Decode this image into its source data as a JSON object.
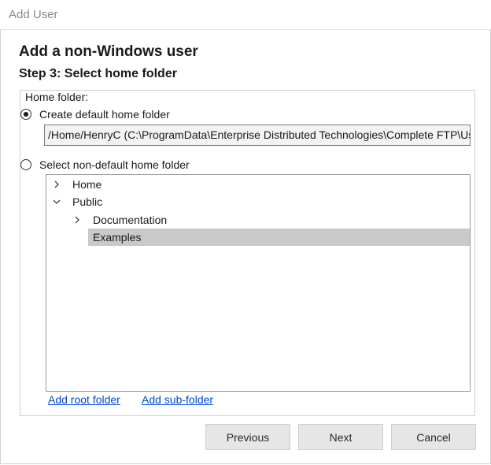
{
  "window": {
    "title": "Add User"
  },
  "header": {
    "heading": "Add a non-Windows user",
    "step": "Step 3: Select home folder"
  },
  "home_folder": {
    "group_label": "Home folder:",
    "option_default": {
      "label": "Create default home folder",
      "checked": true
    },
    "default_path": "/Home/HenryC (C:\\ProgramData\\Enterprise Distributed Technologies\\Complete FTP\\Users\\HenryC)",
    "option_non_default": {
      "label": "Select non-default home folder",
      "checked": false
    }
  },
  "tree": {
    "nodes": [
      {
        "label": "Home",
        "state": "collapsed"
      },
      {
        "label": "Public",
        "state": "expanded"
      },
      {
        "label": "Documentation",
        "state": "collapsed"
      },
      {
        "label": "Examples",
        "state": "selected"
      }
    ]
  },
  "links": {
    "add_root": "Add root folder",
    "add_sub": "Add sub-folder"
  },
  "buttons": {
    "previous": "Previous",
    "next": "Next",
    "cancel": "Cancel"
  },
  "colors": {
    "selected_row": "#c9c9c9",
    "link": "#0046d5",
    "button_bg": "#e6e6e6"
  },
  "icons": {
    "radio_checked": "radio-checked-icon",
    "radio_unchecked": "radio-unchecked-icon",
    "chevron_right": "chevron-right-icon",
    "chevron_down": "chevron-down-icon"
  }
}
